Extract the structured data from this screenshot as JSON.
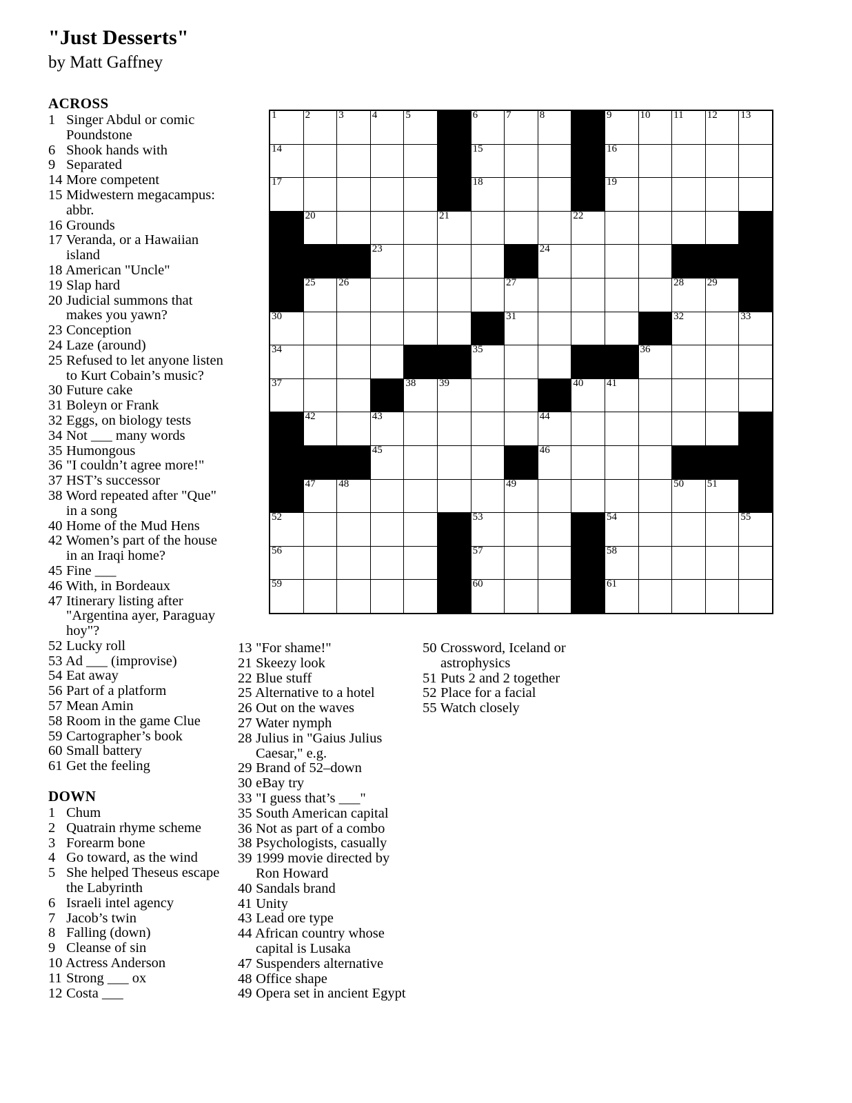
{
  "header": {
    "title": "\"Just Desserts\"",
    "author": "by Matt Gaffney"
  },
  "sections": {
    "across_label": "ACROSS",
    "down_label": "DOWN"
  },
  "across_clues": [
    {
      "num": "1",
      "text": "Singer Abdul or comic Poundstone"
    },
    {
      "num": "6",
      "text": "Shook hands with"
    },
    {
      "num": "9",
      "text": "Separated"
    },
    {
      "num": "14",
      "text": "More competent"
    },
    {
      "num": "15",
      "text": "Midwestern megacampus: abbr."
    },
    {
      "num": "16",
      "text": "Grounds"
    },
    {
      "num": "17",
      "text": "Veranda, or a Hawaiian island"
    },
    {
      "num": "18",
      "text": "American \"Uncle\""
    },
    {
      "num": "19",
      "text": "Slap hard"
    },
    {
      "num": "20",
      "text": "Judicial summons that makes you yawn?"
    },
    {
      "num": "23",
      "text": "Conception"
    },
    {
      "num": "24",
      "text": "Laze (around)"
    },
    {
      "num": "25",
      "text": "Refused to let anyone listen to Kurt Cobain’s music?"
    },
    {
      "num": "30",
      "text": "Future cake"
    },
    {
      "num": "31",
      "text": "Boleyn or Frank"
    },
    {
      "num": "32",
      "text": "Eggs, on biology tests"
    },
    {
      "num": "34",
      "text": "Not ___ many words"
    },
    {
      "num": "35",
      "text": "Humongous"
    },
    {
      "num": "36",
      "text": "\"I couldn’t agree more!\""
    },
    {
      "num": "37",
      "text": "HST’s successor"
    },
    {
      "num": "38",
      "text": "Word repeated after \"Que\" in a song"
    },
    {
      "num": "40",
      "text": "Home of the Mud Hens"
    },
    {
      "num": "42",
      "text": "Women’s part of the house in an Iraqi home?"
    },
    {
      "num": "45",
      "text": "Fine ___"
    },
    {
      "num": "46",
      "text": "With, in Bordeaux"
    },
    {
      "num": "47",
      "text": "Itinerary listing after \"Argentina ayer, Paraguay hoy\"?"
    },
    {
      "num": "52",
      "text": "Lucky roll"
    },
    {
      "num": "53",
      "text": "Ad ___ (improvise)"
    },
    {
      "num": "54",
      "text": "Eat away"
    },
    {
      "num": "56",
      "text": "Part of a platform"
    },
    {
      "num": "57",
      "text": "Mean Amin"
    },
    {
      "num": "58",
      "text": "Room in the game Clue"
    },
    {
      "num": "59",
      "text": "Cartographer’s book"
    },
    {
      "num": "60",
      "text": "Small battery"
    },
    {
      "num": "61",
      "text": "Get the feeling"
    }
  ],
  "down_clues_col1": [
    {
      "num": "1",
      "text": "Chum"
    },
    {
      "num": "2",
      "text": "Quatrain rhyme scheme"
    },
    {
      "num": "3",
      "text": "Forearm bone"
    },
    {
      "num": "4",
      "text": "Go toward, as the wind"
    },
    {
      "num": "5",
      "text": "She helped Theseus escape the Labyrinth"
    },
    {
      "num": "6",
      "text": "Israeli intel agency"
    },
    {
      "num": "7",
      "text": "Jacob’s twin"
    },
    {
      "num": "8",
      "text": "Falling (down)"
    },
    {
      "num": "9",
      "text": "Cleanse of sin"
    },
    {
      "num": "10",
      "text": "Actress Anderson"
    },
    {
      "num": "11",
      "text": "Strong ___ ox"
    },
    {
      "num": "12",
      "text": "Costa ___"
    }
  ],
  "down_clues_col2": [
    {
      "num": "13",
      "text": "\"For shame!\""
    },
    {
      "num": "21",
      "text": "Skeezy look"
    },
    {
      "num": "22",
      "text": "Blue stuff"
    },
    {
      "num": "25",
      "text": "Alternative to a hotel"
    },
    {
      "num": "26",
      "text": "Out on the waves"
    },
    {
      "num": "27",
      "text": "Water nymph"
    },
    {
      "num": "28",
      "text": "Julius in \"Gaius Julius Caesar,\" e.g."
    },
    {
      "num": "29",
      "text": "Brand of 52–down"
    },
    {
      "num": "30",
      "text": "eBay try"
    },
    {
      "num": "33",
      "text": "\"I guess that’s ___\""
    },
    {
      "num": "35",
      "text": "South American capital"
    },
    {
      "num": "36",
      "text": "Not as part of a combo"
    },
    {
      "num": "38",
      "text": "Psychologists, casually"
    },
    {
      "num": "39",
      "text": "1999 movie directed by Ron Howard"
    },
    {
      "num": "40",
      "text": "Sandals brand"
    },
    {
      "num": "41",
      "text": "Unity"
    },
    {
      "num": "43",
      "text": "Lead ore type"
    },
    {
      "num": "44",
      "text": "African country whose capital is Lusaka"
    },
    {
      "num": "47",
      "text": "Suspenders alternative"
    },
    {
      "num": "48",
      "text": "Office shape"
    },
    {
      "num": "49",
      "text": "Opera set in ancient Egypt"
    }
  ],
  "down_clues_col3": [
    {
      "num": "50",
      "text": "Crossword, Iceland or astrophysics"
    },
    {
      "num": "51",
      "text": "Puts 2 and 2 together"
    },
    {
      "num": "52",
      "text": "Place for a facial"
    },
    {
      "num": "55",
      "text": "Watch closely"
    }
  ],
  "grid": {
    "rows": 15,
    "cols": 15,
    "fill_color": "#000000",
    "cell_color": "#ffffff",
    "cells": [
      [
        {
          "b": 0,
          "n": "1"
        },
        {
          "b": 0,
          "n": "2"
        },
        {
          "b": 0,
          "n": "3"
        },
        {
          "b": 0,
          "n": "4"
        },
        {
          "b": 0,
          "n": "5"
        },
        {
          "b": 1,
          "n": ""
        },
        {
          "b": 0,
          "n": "6"
        },
        {
          "b": 0,
          "n": "7"
        },
        {
          "b": 0,
          "n": "8"
        },
        {
          "b": 1,
          "n": ""
        },
        {
          "b": 0,
          "n": "9"
        },
        {
          "b": 0,
          "n": "10"
        },
        {
          "b": 0,
          "n": "11"
        },
        {
          "b": 0,
          "n": "12"
        },
        {
          "b": 0,
          "n": "13"
        }
      ],
      [
        {
          "b": 0,
          "n": "14"
        },
        {
          "b": 0,
          "n": ""
        },
        {
          "b": 0,
          "n": ""
        },
        {
          "b": 0,
          "n": ""
        },
        {
          "b": 0,
          "n": ""
        },
        {
          "b": 1,
          "n": ""
        },
        {
          "b": 0,
          "n": "15"
        },
        {
          "b": 0,
          "n": ""
        },
        {
          "b": 0,
          "n": ""
        },
        {
          "b": 1,
          "n": ""
        },
        {
          "b": 0,
          "n": "16"
        },
        {
          "b": 0,
          "n": ""
        },
        {
          "b": 0,
          "n": ""
        },
        {
          "b": 0,
          "n": ""
        },
        {
          "b": 0,
          "n": ""
        }
      ],
      [
        {
          "b": 0,
          "n": "17"
        },
        {
          "b": 0,
          "n": ""
        },
        {
          "b": 0,
          "n": ""
        },
        {
          "b": 0,
          "n": ""
        },
        {
          "b": 0,
          "n": ""
        },
        {
          "b": 1,
          "n": ""
        },
        {
          "b": 0,
          "n": "18"
        },
        {
          "b": 0,
          "n": ""
        },
        {
          "b": 0,
          "n": ""
        },
        {
          "b": 1,
          "n": ""
        },
        {
          "b": 0,
          "n": "19"
        },
        {
          "b": 0,
          "n": ""
        },
        {
          "b": 0,
          "n": ""
        },
        {
          "b": 0,
          "n": ""
        },
        {
          "b": 0,
          "n": ""
        }
      ],
      [
        {
          "b": 1,
          "n": ""
        },
        {
          "b": 0,
          "n": "20"
        },
        {
          "b": 0,
          "n": ""
        },
        {
          "b": 0,
          "n": ""
        },
        {
          "b": 0,
          "n": ""
        },
        {
          "b": 0,
          "n": "21"
        },
        {
          "b": 0,
          "n": ""
        },
        {
          "b": 0,
          "n": ""
        },
        {
          "b": 0,
          "n": ""
        },
        {
          "b": 0,
          "n": "22"
        },
        {
          "b": 0,
          "n": ""
        },
        {
          "b": 0,
          "n": ""
        },
        {
          "b": 0,
          "n": ""
        },
        {
          "b": 0,
          "n": ""
        },
        {
          "b": 1,
          "n": ""
        }
      ],
      [
        {
          "b": 1,
          "n": ""
        },
        {
          "b": 1,
          "n": ""
        },
        {
          "b": 1,
          "n": ""
        },
        {
          "b": 0,
          "n": "23"
        },
        {
          "b": 0,
          "n": ""
        },
        {
          "b": 0,
          "n": ""
        },
        {
          "b": 0,
          "n": ""
        },
        {
          "b": 1,
          "n": ""
        },
        {
          "b": 0,
          "n": "24"
        },
        {
          "b": 0,
          "n": ""
        },
        {
          "b": 0,
          "n": ""
        },
        {
          "b": 0,
          "n": ""
        },
        {
          "b": 1,
          "n": ""
        },
        {
          "b": 1,
          "n": ""
        },
        {
          "b": 1,
          "n": ""
        }
      ],
      [
        {
          "b": 1,
          "n": ""
        },
        {
          "b": 0,
          "n": "25"
        },
        {
          "b": 0,
          "n": "26"
        },
        {
          "b": 0,
          "n": ""
        },
        {
          "b": 0,
          "n": ""
        },
        {
          "b": 0,
          "n": ""
        },
        {
          "b": 0,
          "n": ""
        },
        {
          "b": 0,
          "n": "27"
        },
        {
          "b": 0,
          "n": ""
        },
        {
          "b": 0,
          "n": ""
        },
        {
          "b": 0,
          "n": ""
        },
        {
          "b": 0,
          "n": ""
        },
        {
          "b": 0,
          "n": "28"
        },
        {
          "b": 0,
          "n": "29"
        },
        {
          "b": 1,
          "n": ""
        }
      ],
      [
        {
          "b": 0,
          "n": "30"
        },
        {
          "b": 0,
          "n": ""
        },
        {
          "b": 0,
          "n": ""
        },
        {
          "b": 0,
          "n": ""
        },
        {
          "b": 0,
          "n": ""
        },
        {
          "b": 0,
          "n": ""
        },
        {
          "b": 1,
          "n": ""
        },
        {
          "b": 0,
          "n": "31"
        },
        {
          "b": 0,
          "n": ""
        },
        {
          "b": 0,
          "n": ""
        },
        {
          "b": 0,
          "n": ""
        },
        {
          "b": 1,
          "n": ""
        },
        {
          "b": 0,
          "n": "32"
        },
        {
          "b": 0,
          "n": ""
        },
        {
          "b": 0,
          "n": "33"
        }
      ],
      [
        {
          "b": 0,
          "n": "34"
        },
        {
          "b": 0,
          "n": ""
        },
        {
          "b": 0,
          "n": ""
        },
        {
          "b": 0,
          "n": ""
        },
        {
          "b": 1,
          "n": ""
        },
        {
          "b": 1,
          "n": ""
        },
        {
          "b": 0,
          "n": "35"
        },
        {
          "b": 0,
          "n": ""
        },
        {
          "b": 0,
          "n": ""
        },
        {
          "b": 1,
          "n": ""
        },
        {
          "b": 1,
          "n": ""
        },
        {
          "b": 0,
          "n": "36"
        },
        {
          "b": 0,
          "n": ""
        },
        {
          "b": 0,
          "n": ""
        },
        {
          "b": 0,
          "n": ""
        }
      ],
      [
        {
          "b": 0,
          "n": "37"
        },
        {
          "b": 0,
          "n": ""
        },
        {
          "b": 0,
          "n": ""
        },
        {
          "b": 1,
          "n": ""
        },
        {
          "b": 0,
          "n": "38"
        },
        {
          "b": 0,
          "n": "39"
        },
        {
          "b": 0,
          "n": ""
        },
        {
          "b": 0,
          "n": ""
        },
        {
          "b": 1,
          "n": ""
        },
        {
          "b": 0,
          "n": "40"
        },
        {
          "b": 0,
          "n": "41"
        },
        {
          "b": 0,
          "n": ""
        },
        {
          "b": 0,
          "n": ""
        },
        {
          "b": 0,
          "n": ""
        },
        {
          "b": 0,
          "n": ""
        }
      ],
      [
        {
          "b": 1,
          "n": ""
        },
        {
          "b": 0,
          "n": "42"
        },
        {
          "b": 0,
          "n": ""
        },
        {
          "b": 0,
          "n": "43"
        },
        {
          "b": 0,
          "n": ""
        },
        {
          "b": 0,
          "n": ""
        },
        {
          "b": 0,
          "n": ""
        },
        {
          "b": 0,
          "n": ""
        },
        {
          "b": 0,
          "n": "44"
        },
        {
          "b": 0,
          "n": ""
        },
        {
          "b": 0,
          "n": ""
        },
        {
          "b": 0,
          "n": ""
        },
        {
          "b": 0,
          "n": ""
        },
        {
          "b": 0,
          "n": ""
        },
        {
          "b": 1,
          "n": ""
        }
      ],
      [
        {
          "b": 1,
          "n": ""
        },
        {
          "b": 1,
          "n": ""
        },
        {
          "b": 1,
          "n": ""
        },
        {
          "b": 0,
          "n": "45"
        },
        {
          "b": 0,
          "n": ""
        },
        {
          "b": 0,
          "n": ""
        },
        {
          "b": 0,
          "n": ""
        },
        {
          "b": 1,
          "n": ""
        },
        {
          "b": 0,
          "n": "46"
        },
        {
          "b": 0,
          "n": ""
        },
        {
          "b": 0,
          "n": ""
        },
        {
          "b": 0,
          "n": ""
        },
        {
          "b": 1,
          "n": ""
        },
        {
          "b": 1,
          "n": ""
        },
        {
          "b": 1,
          "n": ""
        }
      ],
      [
        {
          "b": 1,
          "n": ""
        },
        {
          "b": 0,
          "n": "47"
        },
        {
          "b": 0,
          "n": "48"
        },
        {
          "b": 0,
          "n": ""
        },
        {
          "b": 0,
          "n": ""
        },
        {
          "b": 0,
          "n": ""
        },
        {
          "b": 0,
          "n": ""
        },
        {
          "b": 0,
          "n": "49"
        },
        {
          "b": 0,
          "n": ""
        },
        {
          "b": 0,
          "n": ""
        },
        {
          "b": 0,
          "n": ""
        },
        {
          "b": 0,
          "n": ""
        },
        {
          "b": 0,
          "n": "50"
        },
        {
          "b": 0,
          "n": "51"
        },
        {
          "b": 1,
          "n": ""
        }
      ],
      [
        {
          "b": 0,
          "n": "52"
        },
        {
          "b": 0,
          "n": ""
        },
        {
          "b": 0,
          "n": ""
        },
        {
          "b": 0,
          "n": ""
        },
        {
          "b": 0,
          "n": ""
        },
        {
          "b": 1,
          "n": ""
        },
        {
          "b": 0,
          "n": "53"
        },
        {
          "b": 0,
          "n": ""
        },
        {
          "b": 0,
          "n": ""
        },
        {
          "b": 1,
          "n": ""
        },
        {
          "b": 0,
          "n": "54"
        },
        {
          "b": 0,
          "n": ""
        },
        {
          "b": 0,
          "n": ""
        },
        {
          "b": 0,
          "n": ""
        },
        {
          "b": 0,
          "n": "55"
        }
      ],
      [
        {
          "b": 0,
          "n": "56"
        },
        {
          "b": 0,
          "n": ""
        },
        {
          "b": 0,
          "n": ""
        },
        {
          "b": 0,
          "n": ""
        },
        {
          "b": 0,
          "n": ""
        },
        {
          "b": 1,
          "n": ""
        },
        {
          "b": 0,
          "n": "57"
        },
        {
          "b": 0,
          "n": ""
        },
        {
          "b": 0,
          "n": ""
        },
        {
          "b": 1,
          "n": ""
        },
        {
          "b": 0,
          "n": "58"
        },
        {
          "b": 0,
          "n": ""
        },
        {
          "b": 0,
          "n": ""
        },
        {
          "b": 0,
          "n": ""
        },
        {
          "b": 0,
          "n": ""
        }
      ],
      [
        {
          "b": 0,
          "n": "59"
        },
        {
          "b": 0,
          "n": ""
        },
        {
          "b": 0,
          "n": ""
        },
        {
          "b": 0,
          "n": ""
        },
        {
          "b": 0,
          "n": ""
        },
        {
          "b": 1,
          "n": ""
        },
        {
          "b": 0,
          "n": "60"
        },
        {
          "b": 0,
          "n": ""
        },
        {
          "b": 0,
          "n": ""
        },
        {
          "b": 1,
          "n": ""
        },
        {
          "b": 0,
          "n": "61"
        },
        {
          "b": 0,
          "n": ""
        },
        {
          "b": 0,
          "n": ""
        },
        {
          "b": 0,
          "n": ""
        },
        {
          "b": 0,
          "n": ""
        }
      ]
    ]
  }
}
